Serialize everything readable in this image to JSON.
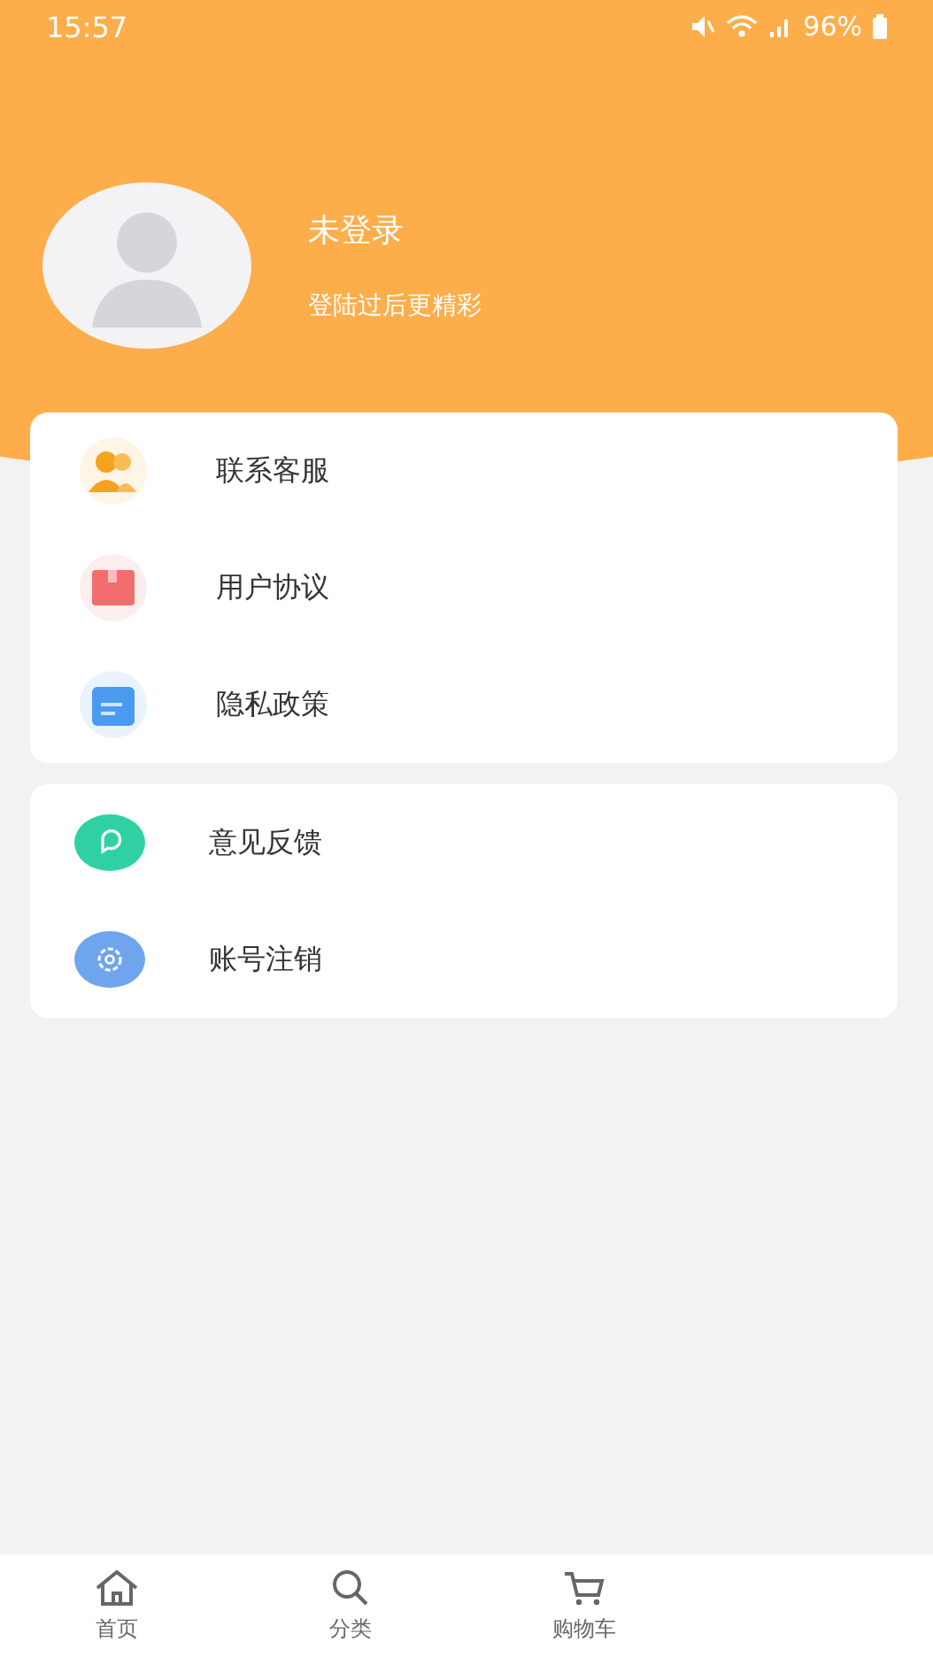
{
  "status_bar": {
    "time": "15:57",
    "battery": "96%"
  },
  "profile": {
    "name": "未登录",
    "subtitle": "登陆过后更精彩"
  },
  "menu_groups": [
    {
      "items": [
        {
          "label": "联系客服",
          "kind": "people"
        },
        {
          "label": "用户协议",
          "kind": "box"
        },
        {
          "label": "隐私政策",
          "kind": "calendar"
        }
      ]
    },
    {
      "items": [
        {
          "label": "意见反馈",
          "kind": "feedback"
        },
        {
          "label": "账号注销",
          "kind": "gear"
        }
      ]
    }
  ],
  "tab_bar": [
    {
      "label": "首页",
      "kind": "home",
      "selected": false
    },
    {
      "label": "分类",
      "kind": "search",
      "selected": false
    },
    {
      "label": "购物车",
      "kind": "cart",
      "selected": false
    }
  ]
}
